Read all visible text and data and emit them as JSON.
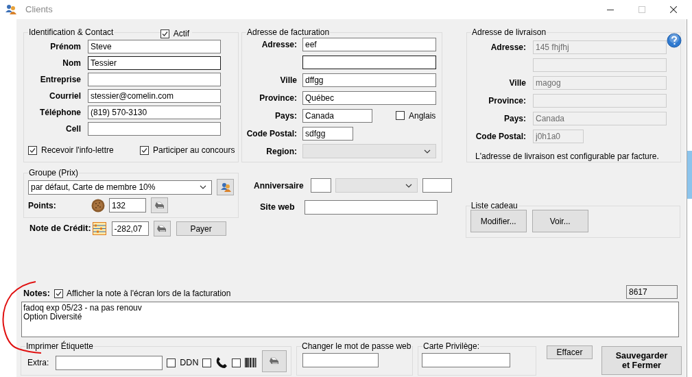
{
  "window": {
    "title": "Clients"
  },
  "identification": {
    "title": "Identification & Contact",
    "active": {
      "label": "Actif",
      "checked": true
    },
    "fields": [
      {
        "label": "Prénom",
        "value": "Steve",
        "focused": false
      },
      {
        "label": "Nom",
        "value": "Tessier",
        "focused": true
      },
      {
        "label": "Entreprise",
        "focused": false
      },
      {
        "label": "Courriel",
        "value": "stessier@comelin.com",
        "focused": false
      },
      {
        "label": "Téléphone",
        "value": "(819) 570-3130",
        "focused": false
      },
      {
        "label": "Cell",
        "focused": false
      }
    ],
    "checkboxes": [
      {
        "label": "Recevoir l'info-lettre",
        "checked": true
      },
      {
        "label": "Participer au concours",
        "checked": true
      }
    ]
  },
  "billing": {
    "title": "Adresse de facturation",
    "fields": [
      {
        "kind": "wide",
        "label": "Adresse:",
        "value": "eef",
        "focused": false
      },
      {
        "kind": "wide",
        "focused": true
      },
      {
        "kind": "wide",
        "label": "Ville",
        "value": "dffgg",
        "focused": false
      },
      {
        "kind": "wide",
        "label": "Province:",
        "value": "Québec",
        "focused": false
      },
      {
        "kind": "medium",
        "label": "Pays:",
        "value": "Canada",
        "focused": false,
        "checkbox": {
          "label": "Anglais",
          "checked": false
        }
      },
      {
        "kind": "short",
        "label": "Code Postal:",
        "value": "sdfgg",
        "focused": false
      },
      {
        "kind": "select",
        "label": "Region:",
        "disabled": true
      }
    ]
  },
  "shipping": {
    "title": "Adresse de livraison",
    "fields": [
      {
        "kind": "wide",
        "label": "Adresse:",
        "value": "145 fhjfhj",
        "disabled": true
      },
      {
        "kind": "wide",
        "disabled": true
      },
      {
        "kind": "wide",
        "label": "Ville",
        "value": "magog",
        "disabled": true
      },
      {
        "kind": "wide",
        "label": "Province:",
        "disabled": true
      },
      {
        "kind": "wide",
        "label": "Pays:",
        "value": "Canada",
        "disabled": true
      },
      {
        "kind": "short",
        "label": "Code Postal:",
        "value": "j0h1a0",
        "disabled": true
      }
    ],
    "note": "L'adresse de livraison est configurable par facture."
  },
  "price_group": {
    "title": "Groupe (Prix)",
    "selected_group": "par défaut, Carte de membre 10%",
    "points": {
      "label": "Points:",
      "value": "132"
    }
  },
  "credit": {
    "label": "Note de Crédit:",
    "value": "-282,07",
    "pay_button": "Payer"
  },
  "birthday": {
    "label": "Anniversaire",
    "month_disabled": true
  },
  "website": {
    "label": "Site web"
  },
  "gift_list": {
    "title": "Liste cadeau",
    "buttons": [
      "Modifier...",
      "Voir..."
    ]
  },
  "notes": {
    "label": "Notes:",
    "show_on_invoice": {
      "label": "Afficher la note à l'écran lors de la facturation",
      "checked": true
    },
    "text": "fadoq exp 05/23 - na pas renouv\nOption Diversité",
    "client_number": "8617"
  },
  "label_print": {
    "title": "Imprimer Étiquette",
    "extra_label": "Extra:",
    "options": [
      {
        "kind": "text",
        "label": "DDN",
        "checked": false
      },
      {
        "kind": "phone",
        "checked": false
      },
      {
        "kind": "barcode",
        "checked": false
      }
    ]
  },
  "web_password": {
    "title": "Changer le mot de passe web"
  },
  "privilege_card": {
    "title": "Carte Privilège:"
  },
  "buttons": {
    "clear": "Effacer",
    "save": "Sauvegarder et Fermer"
  }
}
